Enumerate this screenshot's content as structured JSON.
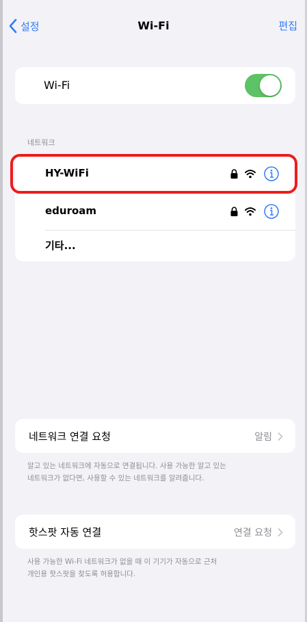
{
  "nav": {
    "back_label": "설정",
    "title": "Wi-Fi",
    "edit_label": "편집"
  },
  "wifi_toggle": {
    "label": "Wi-Fi",
    "on": true
  },
  "networks_section": {
    "header": "네트워크",
    "items": [
      {
        "name": "HY-WiFi",
        "secured": true
      },
      {
        "name": "eduroam",
        "secured": true
      },
      {
        "name": "기타..."
      }
    ]
  },
  "ask_to_join": {
    "label": "네트워크 연결 요청",
    "value": "알림",
    "description": [
      "알고 있는 네트워크에 자동으로 연결됩니다. 사용 가능한 알고 있는",
      "네트워크가 없다면, 사용할 수 있는 네트워크를 알려줍니다."
    ]
  },
  "auto_hotspot": {
    "label": "핫스팟 자동 연결",
    "value": "연결 요청",
    "description": [
      "사용 가능한 Wi-Fi 네트워크가 없을 때 이 기기가 자동으로 근처",
      "개인용 핫스팟을 찾도록 허용합니다."
    ]
  },
  "colors": {
    "accent": "#2f7cf6",
    "toggle_on": "#5ec266",
    "highlight": "#ee1c1c",
    "background": "#f2f2f7"
  }
}
